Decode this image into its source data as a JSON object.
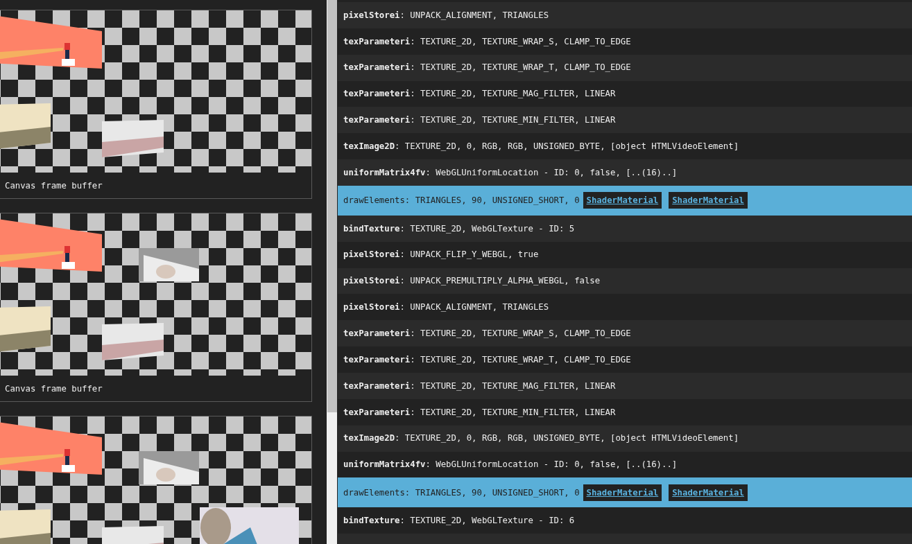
{
  "frames": [
    {
      "image": {
        "kind": "picture"
      },
      "caption": "Canvas frame buffer"
    },
    {
      "image": {
        "kind": "picture"
      },
      "caption": "Canvas frame buffer"
    },
    {
      "image": {
        "kind": "picture"
      }
    }
  ],
  "calls": [
    {
      "text": "**pixelStorei**: UNPACK_ALIGNMENT, TRIANGLES",
      "selected": false
    },
    {
      "text": "**texParameteri**: TEXTURE_2D, TEXTURE_WRAP_S, CLAMP_TO_EDGE",
      "selected": false
    },
    {
      "text": "**texParameteri**: TEXTURE_2D, TEXTURE_WRAP_T, CLAMP_TO_EDGE",
      "selected": false
    },
    {
      "text": "**texParameteri**: TEXTURE_2D, TEXTURE_MAG_FILTER, LINEAR",
      "selected": false
    },
    {
      "text": "**texParameteri**: TEXTURE_2D, TEXTURE_MIN_FILTER, LINEAR",
      "selected": false
    },
    {
      "text": "**texImage2D**: TEXTURE_2D, 0, RGB, RGB, UNSIGNED_BYTE, [object HTMLVideoElement]",
      "selected": false
    },
    {
      "text": "**uniformMatrix4fv**: WebGLUniformLocation - ID: 0, false, [..(16)..]",
      "selected": false
    },
    {
      "text": "drawElements: TRIANGLES, 90, UNSIGNED_SHORT, 0",
      "selected": true,
      "links": [
        "ShaderMaterial",
        "ShaderMaterial"
      ]
    },
    {
      "text": "**bindTexture**: TEXTURE_2D, WebGLTexture - ID: 5",
      "selected": false
    },
    {
      "text": "**pixelStorei**: UNPACK_FLIP_Y_WEBGL, true",
      "selected": false
    },
    {
      "text": "**pixelStorei**: UNPACK_PREMULTIPLY_ALPHA_WEBGL, false",
      "selected": false
    },
    {
      "text": "**pixelStorei**: UNPACK_ALIGNMENT, TRIANGLES",
      "selected": false
    },
    {
      "text": "**texParameteri**: TEXTURE_2D, TEXTURE_WRAP_S, CLAMP_TO_EDGE",
      "selected": false
    },
    {
      "text": "**texParameteri**: TEXTURE_2D, TEXTURE_WRAP_T, CLAMP_TO_EDGE",
      "selected": false
    },
    {
      "text": "**texParameteri**: TEXTURE_2D, TEXTURE_MAG_FILTER, LINEAR",
      "selected": false
    },
    {
      "text": "**texParameteri**: TEXTURE_2D, TEXTURE_MIN_FILTER, LINEAR",
      "selected": false
    },
    {
      "text": "**texImage2D**: TEXTURE_2D, 0, RGB, RGB, UNSIGNED_BYTE, [object HTMLVideoElement]",
      "selected": false
    },
    {
      "text": "**uniformMatrix4fv**: WebGLUniformLocation - ID: 0, false, [..(16)..]",
      "selected": false
    },
    {
      "text": "drawElements: TRIANGLES, 90, UNSIGNED_SHORT, 0",
      "selected": true,
      "links": [
        "ShaderMaterial",
        "ShaderMaterial"
      ]
    },
    {
      "text": "**bindTexture**: TEXTURE_2D, WebGLTexture - ID: 6",
      "selected": false
    }
  ]
}
